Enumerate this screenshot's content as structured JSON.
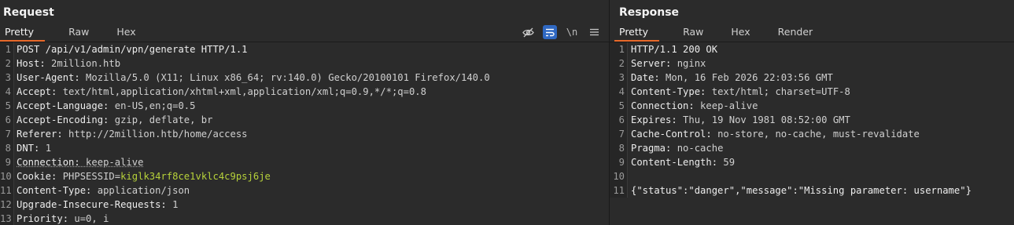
{
  "request": {
    "title": "Request",
    "tabs": [
      "Pretty",
      "Raw",
      "Hex"
    ],
    "toolbar": {
      "wrap_label": "\\n"
    },
    "lines": [
      {
        "n": "1",
        "key": "POST /api/v1/admin/vpn/generate HTTP/1.1",
        "val": ""
      },
      {
        "n": "2",
        "key": "Host:",
        "val": " 2million.htb"
      },
      {
        "n": "3",
        "key": "User-Agent:",
        "val": " Mozilla/5.0 (X11; Linux x86_64; rv:140.0) Gecko/20100101 Firefox/140.0"
      },
      {
        "n": "4",
        "key": "Accept:",
        "val": " text/html,application/xhtml+xml,application/xml;q=0.9,*/*;q=0.8"
      },
      {
        "n": "5",
        "key": "Accept-Language:",
        "val": " en-US,en;q=0.5"
      },
      {
        "n": "6",
        "key": "Accept-Encoding:",
        "val": " gzip, deflate, br"
      },
      {
        "n": "7",
        "key": "Referer:",
        "val": " http://2million.htb/home/access"
      },
      {
        "n": "8",
        "key": "DNT:",
        "val": " 1"
      },
      {
        "n": "9",
        "key": "Connection:",
        "val": " keep-alive"
      },
      {
        "n": "10",
        "key": "Cookie:",
        "val": " PHPSESSID=",
        "hl": "kiglk34rf8ce1vklc4c9psj6je"
      },
      {
        "n": "11",
        "key": "Content-Type:",
        "val": " application/json"
      },
      {
        "n": "12",
        "key": "Upgrade-Insecure-Requests:",
        "val": " 1"
      },
      {
        "n": "13",
        "key": "Priority:",
        "val": " u=0, i"
      }
    ]
  },
  "response": {
    "title": "Response",
    "tabs": [
      "Pretty",
      "Raw",
      "Hex",
      "Render"
    ],
    "lines": [
      {
        "n": "1",
        "key": "HTTP/1.1 200 OK",
        "val": ""
      },
      {
        "n": "2",
        "key": "Server:",
        "val": " nginx"
      },
      {
        "n": "3",
        "key": "Date:",
        "val": " Mon, 16 Feb 2026 22:03:56 GMT"
      },
      {
        "n": "4",
        "key": "Content-Type:",
        "val": " text/html; charset=UTF-8"
      },
      {
        "n": "5",
        "key": "Connection:",
        "val": " keep-alive"
      },
      {
        "n": "6",
        "key": "Expires:",
        "val": " Thu, 19 Nov 1981 08:52:00 GMT"
      },
      {
        "n": "7",
        "key": "Cache-Control:",
        "val": " no-store, no-cache, must-revalidate"
      },
      {
        "n": "8",
        "key": "Pragma:",
        "val": " no-cache"
      },
      {
        "n": "9",
        "key": "Content-Length:",
        "val": " 59"
      },
      {
        "n": "10",
        "key": "",
        "val": ""
      },
      {
        "n": "11",
        "key": "{\"status\":\"danger\",\"message\":\"Missing parameter: username\"}",
        "val": ""
      }
    ]
  }
}
